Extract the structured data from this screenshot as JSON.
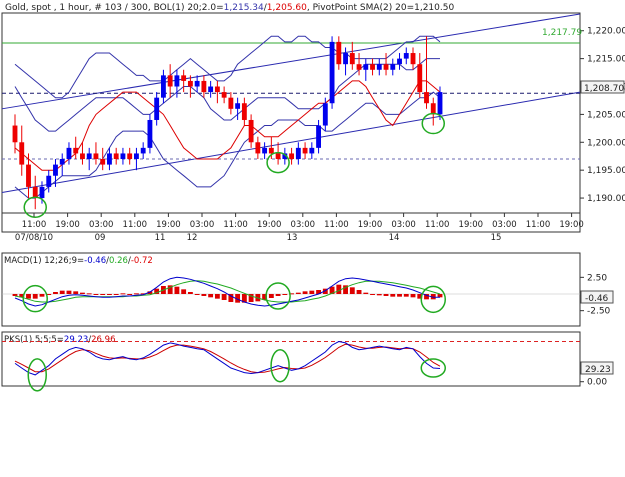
{
  "colors": {
    "up": "#0000ee",
    "down": "#ee0000",
    "bb_mid": "#dd0000",
    "bb_band": "#3333aa",
    "sma": "#3333aa",
    "channel": "#2a2ab0",
    "level": "#33aa33",
    "pivot": "#1a1a6e",
    "dotted": "#6a6ab0",
    "circle": "#22aa22",
    "macd_line": "#0000cc",
    "macd_signal": "#22aa22",
    "hist": "#dd0000",
    "pks_blue": "#0000cc",
    "pks_red": "#cc0000",
    "pks_dash": "#dd2222",
    "frame": "#333333",
    "grid_text": "#222222",
    "label_bg": "#f0f0f0"
  },
  "chart_data": [
    {
      "type": "candlestick",
      "header": {
        "p1": "Gold, spot , 1 hour, # 103 / 300, BOL(1) 20;2.0=",
        "v1": "1,215.34",
        "p2": "/",
        "v2": "1,205.60",
        "p3": ", PivotPoint SMA(2) 20=1,210.50"
      },
      "y_ticks": [
        "1,220.00",
        "1,215.00",
        "1,210.00",
        "1,205.00",
        "1,200.00",
        "1,195.00",
        "1,190.00"
      ],
      "ylim": [
        1187.5,
        1223
      ],
      "level_label": "1,217.79",
      "level_value": 1217.79,
      "pivot_value": 1208.8,
      "pivot_label": "1,208.70",
      "dotted_value": 1197.0,
      "x_time_labels": [
        "11:00",
        "19:00",
        "03:00",
        "11:00",
        "19:00",
        "03:00",
        "11:00",
        "19:00",
        "03:00",
        "11:00",
        "19:00",
        "03:00",
        "11:00",
        "19:00",
        "03:00",
        "11:00",
        "19:00"
      ],
      "x_date_labels": [
        "07/08/10",
        "09",
        "11",
        "12",
        "13",
        "14",
        "15"
      ],
      "candles": [
        [
          1203,
          1205,
          1198,
          1200
        ],
        [
          1200,
          1203,
          1194,
          1196
        ],
        [
          1196,
          1198,
          1190,
          1192
        ],
        [
          1192,
          1194,
          1188,
          1190
        ],
        [
          1190,
          1193,
          1189,
          1192
        ],
        [
          1192,
          1195,
          1191,
          1194
        ],
        [
          1194,
          1197,
          1192,
          1196
        ],
        [
          1196,
          1198,
          1194,
          1197
        ],
        [
          1197,
          1200,
          1196,
          1199
        ],
        [
          1199,
          1201,
          1197,
          1198
        ],
        [
          1198,
          1200,
          1196,
          1197
        ],
        [
          1197,
          1199,
          1195,
          1198
        ],
        [
          1198,
          1200,
          1196,
          1197
        ],
        [
          1197,
          1199,
          1195,
          1196
        ],
        [
          1196,
          1199,
          1195,
          1198
        ],
        [
          1198,
          1199,
          1196,
          1197
        ],
        [
          1197,
          1199,
          1196,
          1198
        ],
        [
          1198,
          1199,
          1196,
          1197
        ],
        [
          1197,
          1199,
          1195,
          1198
        ],
        [
          1198,
          1200,
          1197,
          1199
        ],
        [
          1199,
          1205,
          1198,
          1204
        ],
        [
          1204,
          1209,
          1203,
          1208
        ],
        [
          1208,
          1213,
          1207,
          1212
        ],
        [
          1212,
          1214,
          1208,
          1210
        ],
        [
          1210,
          1213,
          1208,
          1212
        ],
        [
          1212,
          1213,
          1209,
          1211
        ],
        [
          1211,
          1212,
          1208,
          1210
        ],
        [
          1210,
          1212,
          1209,
          1211
        ],
        [
          1211,
          1212,
          1208,
          1209
        ],
        [
          1209,
          1211,
          1208,
          1210
        ],
        [
          1210,
          1211,
          1207,
          1209
        ],
        [
          1209,
          1210,
          1207,
          1208
        ],
        [
          1208,
          1209,
          1205,
          1206
        ],
        [
          1206,
          1208,
          1204,
          1207
        ],
        [
          1207,
          1208,
          1203,
          1204
        ],
        [
          1204,
          1205,
          1199,
          1200
        ],
        [
          1200,
          1201,
          1197,
          1198
        ],
        [
          1198,
          1200,
          1197,
          1199
        ],
        [
          1199,
          1201,
          1197,
          1198
        ],
        [
          1198,
          1200,
          1196,
          1197
        ],
        [
          1197,
          1199,
          1196,
          1198
        ],
        [
          1198,
          1199,
          1196,
          1197
        ],
        [
          1197,
          1200,
          1196,
          1199
        ],
        [
          1199,
          1200,
          1197,
          1198
        ],
        [
          1198,
          1200,
          1197,
          1199
        ],
        [
          1199,
          1204,
          1198,
          1203
        ],
        [
          1203,
          1208,
          1202,
          1207
        ],
        [
          1207,
          1219,
          1206,
          1218
        ],
        [
          1218,
          1219,
          1213,
          1214
        ],
        [
          1214,
          1217,
          1212,
          1216
        ],
        [
          1216,
          1218,
          1213,
          1214
        ],
        [
          1214,
          1216,
          1212,
          1213
        ],
        [
          1213,
          1215,
          1211,
          1214
        ],
        [
          1214,
          1215,
          1212,
          1213
        ],
        [
          1213,
          1215,
          1212,
          1214
        ],
        [
          1214,
          1216,
          1212,
          1213
        ],
        [
          1213,
          1215,
          1212,
          1214
        ],
        [
          1214,
          1216,
          1213,
          1215
        ],
        [
          1215,
          1217,
          1214,
          1216
        ],
        [
          1216,
          1217,
          1213,
          1214
        ],
        [
          1214,
          1216,
          1208,
          1209
        ],
        [
          1209,
          1219,
          1206,
          1207
        ],
        [
          1207,
          1208,
          1203,
          1205
        ],
        [
          1205,
          1210,
          1204,
          1209
        ]
      ],
      "bb_mid": [
        1199,
        1198,
        1197,
        1196,
        1195,
        1195,
        1195,
        1196,
        1197,
        1198,
        1200,
        1203,
        1205,
        1206,
        1207,
        1208,
        1209,
        1209,
        1209,
        1208,
        1207,
        1206,
        1205,
        1203,
        1201,
        1199,
        1198,
        1197,
        1197,
        1197,
        1197,
        1198,
        1199,
        1201,
        1203,
        1203,
        1202,
        1201,
        1201,
        1201,
        1202,
        1203,
        1204,
        1205,
        1206,
        1207,
        1207,
        1208,
        1209,
        1210,
        1211,
        1211,
        1210,
        1208,
        1206,
        1204,
        1203,
        1205,
        1207,
        1209,
        1211,
        1211,
        1210,
        1209
      ],
      "bb_upper": [
        1214,
        1213,
        1212,
        1211,
        1210,
        1209,
        1208,
        1208,
        1209,
        1211,
        1213,
        1215,
        1216,
        1216,
        1216,
        1215,
        1214,
        1213,
        1212,
        1212,
        1211,
        1211,
        1211,
        1212,
        1213,
        1214,
        1215,
        1214,
        1213,
        1212,
        1211,
        1211,
        1212,
        1214,
        1215,
        1216,
        1217,
        1218,
        1219,
        1219,
        1218,
        1218,
        1219,
        1219,
        1218,
        1218,
        1217,
        1217,
        1216,
        1216,
        1215,
        1215,
        1215,
        1215,
        1215,
        1215,
        1216,
        1217,
        1218,
        1218,
        1219,
        1219,
        1219,
        1218
      ],
      "bb_lower": [
        1192,
        1191,
        1190,
        1190,
        1191,
        1192,
        1193,
        1194,
        1194,
        1194,
        1194,
        1194,
        1195,
        1197,
        1199,
        1201,
        1202,
        1202,
        1202,
        1202,
        1201,
        1199,
        1197,
        1196,
        1195,
        1194,
        1193,
        1192,
        1192,
        1192,
        1193,
        1194,
        1196,
        1198,
        1200,
        1201,
        1202,
        1203,
        1203,
        1204,
        1204,
        1204,
        1204,
        1203,
        1203,
        1203,
        1202,
        1202,
        1203,
        1204,
        1205,
        1206,
        1207,
        1207,
        1206,
        1205,
        1205,
        1205,
        1206,
        1207,
        1208,
        1208,
        1209,
        1208
      ],
      "sma": [
        1210,
        1208,
        1206,
        1204,
        1203,
        1202,
        1202,
        1203,
        1204,
        1205,
        1206,
        1207,
        1208,
        1208,
        1208,
        1208,
        1208,
        1207,
        1206,
        1205,
        1205,
        1206,
        1207,
        1208,
        1209,
        1210,
        1210,
        1209,
        1208,
        1206,
        1205,
        1204,
        1204,
        1205,
        1206,
        1207,
        1208,
        1208,
        1208,
        1208,
        1208,
        1207,
        1206,
        1206,
        1206,
        1206,
        1207,
        1208,
        1210,
        1211,
        1212,
        1213,
        1214,
        1214,
        1214,
        1214,
        1214,
        1214,
        1213,
        1213,
        1214,
        1215,
        1215,
        1215
      ],
      "channel_upper": [
        1206,
        1223
      ],
      "channel_lower": [
        1191,
        1209
      ],
      "circled_bars": [
        3,
        39,
        62
      ]
    },
    {
      "type": "line",
      "title": "MACD(1) 12;26;9=",
      "t_v1": "-0.46",
      "t_sep": "/",
      "t_v2": "0.26",
      "t_sep2": "/",
      "t_v3": "-0.72",
      "y_ticks": [
        "2.50",
        "-2.50"
      ],
      "ylim": [
        -4.2,
        4.2
      ],
      "value_label": "-0.46",
      "macd": [
        -0.6,
        -1.0,
        -1.5,
        -1.8,
        -1.6,
        -1.2,
        -0.8,
        -0.4,
        -0.2,
        -0.1,
        -0.2,
        -0.3,
        -0.4,
        -0.5,
        -0.5,
        -0.4,
        -0.3,
        -0.3,
        -0.2,
        -0.1,
        0.3,
        1.0,
        1.8,
        2.3,
        2.5,
        2.4,
        2.2,
        1.9,
        1.6,
        1.2,
        0.8,
        0.3,
        -0.3,
        -0.8,
        -1.2,
        -1.5,
        -1.7,
        -1.8,
        -1.7,
        -1.5,
        -1.3,
        -1.1,
        -0.9,
        -0.6,
        -0.3,
        0.0,
        0.5,
        1.2,
        1.9,
        2.3,
        2.4,
        2.3,
        2.1,
        1.9,
        1.7,
        1.5,
        1.3,
        1.1,
        0.9,
        0.6,
        0.2,
        -0.2,
        -0.5,
        -0.5
      ],
      "signal": [
        -0.3,
        -0.5,
        -0.8,
        -1.1,
        -1.2,
        -1.2,
        -1.1,
        -0.9,
        -0.7,
        -0.5,
        -0.4,
        -0.4,
        -0.4,
        -0.4,
        -0.4,
        -0.4,
        -0.4,
        -0.3,
        -0.3,
        -0.2,
        -0.1,
        0.2,
        0.6,
        1.0,
        1.4,
        1.7,
        1.9,
        2.0,
        1.9,
        1.7,
        1.5,
        1.2,
        0.9,
        0.5,
        0.1,
        -0.3,
        -0.6,
        -0.9,
        -1.1,
        -1.2,
        -1.2,
        -1.2,
        -1.1,
        -1.0,
        -0.8,
        -0.6,
        -0.3,
        0.1,
        0.5,
        1.0,
        1.4,
        1.7,
        1.9,
        1.9,
        1.9,
        1.8,
        1.7,
        1.5,
        1.3,
        1.1,
        0.9,
        0.6,
        0.3,
        0.0
      ],
      "hist": [
        -0.3,
        -0.5,
        -0.7,
        -0.7,
        -0.4,
        0.0,
        0.3,
        0.5,
        0.5,
        0.4,
        0.2,
        0.1,
        0.0,
        -0.1,
        -0.1,
        0.0,
        0.1,
        0.0,
        0.1,
        0.1,
        0.4,
        0.8,
        1.2,
        1.3,
        1.1,
        0.7,
        0.3,
        -0.1,
        -0.3,
        -0.5,
        -0.7,
        -0.9,
        -1.2,
        -1.3,
        -1.3,
        -1.2,
        -1.1,
        -0.9,
        -0.6,
        -0.3,
        -0.1,
        0.1,
        0.2,
        0.4,
        0.5,
        0.6,
        0.8,
        1.1,
        1.4,
        1.3,
        1.0,
        0.6,
        0.2,
        0.0,
        -0.2,
        -0.3,
        -0.4,
        -0.4,
        -0.4,
        -0.5,
        -0.7,
        -0.8,
        -0.8,
        -0.5
      ],
      "circled_bars": [
        3,
        39,
        62
      ]
    },
    {
      "type": "line",
      "title": "PKS(1) 5;5;5=",
      "t_v1": "29.23",
      "t_sep": "/",
      "t_v2": "26.96",
      "y_ticks": [
        "0.00"
      ],
      "ylim": [
        -5,
        100
      ],
      "dash_value": 88,
      "value_label": "29.23",
      "blue": [
        40,
        30,
        20,
        15,
        25,
        35,
        50,
        60,
        70,
        75,
        72,
        65,
        55,
        50,
        48,
        52,
        55,
        50,
        48,
        52,
        60,
        70,
        80,
        85,
        82,
        78,
        75,
        72,
        70,
        60,
        50,
        40,
        30,
        25,
        20,
        18,
        20,
        25,
        30,
        35,
        30,
        25,
        28,
        35,
        45,
        55,
        65,
        80,
        88,
        85,
        75,
        70,
        72,
        75,
        78,
        75,
        72,
        70,
        75,
        72,
        55,
        40,
        30,
        29
      ],
      "red": [
        45,
        38,
        30,
        22,
        22,
        28,
        38,
        48,
        58,
        66,
        70,
        68,
        62,
        56,
        52,
        51,
        52,
        51,
        50,
        50,
        54,
        60,
        68,
        76,
        80,
        80,
        78,
        75,
        72,
        66,
        58,
        50,
        41,
        33,
        27,
        22,
        20,
        21,
        24,
        28,
        31,
        29,
        28,
        30,
        36,
        44,
        53,
        64,
        75,
        82,
        80,
        76,
        73,
        73,
        75,
        76,
        74,
        72,
        73,
        72,
        65,
        54,
        42,
        34
      ],
      "circled_bars": [
        3,
        39,
        62
      ]
    }
  ]
}
